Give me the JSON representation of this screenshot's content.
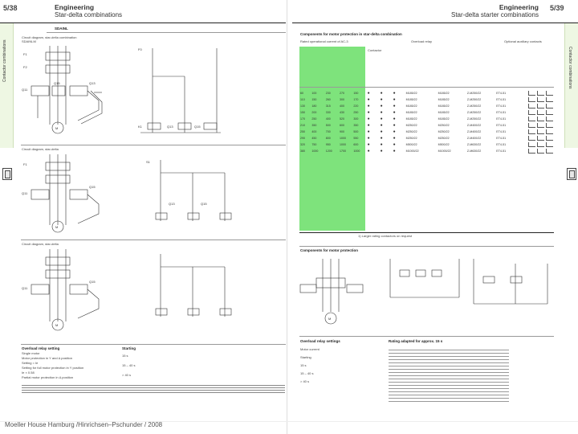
{
  "left_page": {
    "page_number": "5/38",
    "header_title": "Engineering",
    "header_subtitle": "Star-delta combinations",
    "sidebar_label": "Contactor combinations",
    "product_code": "SDAINL",
    "circuits": [
      {
        "title": "Circuit diagram, star-delta combination",
        "code": "SDAINLM"
      },
      {
        "title": "Circuit diagram, star-delta",
        "code": ""
      },
      {
        "title": "Circuit diagram, star-delta",
        "code": ""
      }
    ],
    "notes_title": "Overload relay setting",
    "notes_right_title": "Starting",
    "notes": [
      "Single motor",
      "Motor protection in Y and Δ position",
      "Setting = Ie",
      "Setting for full motor protection in Y position",
      "Ie × 0.58",
      "Partial motor protection in Δ position"
    ],
    "notes_values": [
      "15 s",
      "15 – 40 s",
      "> 40 s"
    ]
  },
  "right_page": {
    "page_number": "5/39",
    "header_title": "Engineering",
    "header_subtitle": "Star-delta starter combinations",
    "sidebar_label": "Contactor combinations",
    "table_title": "Components for motor protection in star-delta combination",
    "column_groups": [
      "Rated operational current of AC-3",
      "Contactor",
      "Overload relay",
      "Optional auxiliary contacts"
    ],
    "rows": [
      [
        "60",
        "100",
        "230",
        "270",
        "150",
        "●",
        "●",
        "●",
        "M185/22",
        "M185/22",
        "Z-M250/22",
        "ET4-51"
      ],
      [
        "110",
        "150",
        "260",
        "300",
        "170",
        "●",
        "●",
        "●",
        "M185/22",
        "M185/22",
        "Z-M250/22",
        "ET4-51"
      ],
      [
        "130",
        "180",
        "315",
        "400",
        "220",
        "●",
        "●",
        "●",
        "M185/22",
        "M185/22",
        "Z-M250/22",
        "ET4-51"
      ],
      [
        "150",
        "200",
        "330",
        "430",
        "250",
        "●",
        "●",
        "●",
        "M185/22",
        "M185/22",
        "Z-M250/22",
        "ET4-51"
      ],
      [
        "170",
        "250",
        "400",
        "520",
        "300",
        "●",
        "●",
        "●",
        "M185/22",
        "M185/22",
        "Z-M250/22",
        "ET4-51"
      ],
      [
        "210",
        "350",
        "500",
        "600",
        "350",
        "●",
        "●",
        "●",
        "M250/22",
        "M250/22",
        "Z-M400/22",
        "ET4-51"
      ],
      [
        "250",
        "400",
        "700",
        "900",
        "500",
        "●",
        "●",
        "●",
        "M250/22",
        "M250/22",
        "Z-M400/22",
        "ET4-51"
      ],
      [
        "290",
        "450",
        "800",
        "1000",
        "550",
        "●",
        "●",
        "●",
        "M250/22",
        "M250/22",
        "Z-M400/22",
        "ET4-51"
      ],
      [
        "320",
        "750",
        "950",
        "1000",
        "600",
        "●",
        "●",
        "●",
        "M500/22",
        "M500/22",
        "Z-M630/22",
        "ET4-51"
      ],
      [
        "380",
        "1000",
        "1200",
        "1700",
        "1000",
        "●",
        "●",
        "●",
        "M1000/22",
        "M1000/22",
        "Z-M630/22",
        "ET4-51"
      ]
    ],
    "footnote": "1) Larger rating contactors on request",
    "lower_section_title": "Components for motor protection",
    "notes_title": "Overload relay settings",
    "notes_right_title": "Rating adapted for approx. 15 s",
    "notes": [
      "Motor current",
      "Starting",
      "15 s",
      "15 – 40 s",
      "> 40 s"
    ]
  },
  "footer": {
    "credit": "Moeller House Hamburg /Hinrichsen–Pschunder / 2008"
  }
}
